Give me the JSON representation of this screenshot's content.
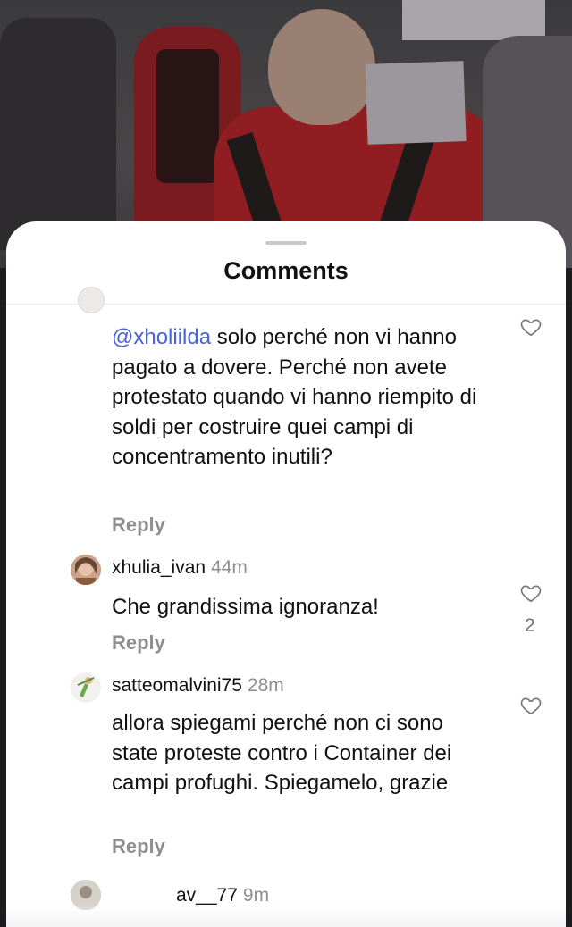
{
  "sheet": {
    "title": "Comments"
  },
  "comments": [
    {
      "mention": "@xholiilda",
      "text": " solo perché non vi hanno pagato a dovere. Perché non avete protestato quando vi hanno riempito di soldi per costruire quei campi di concentramento inutili?",
      "reply_label": "Reply"
    },
    {
      "username": "xhulia_ivan",
      "time": "44m",
      "text": "Che grandissima ignoranza!",
      "reply_label": "Reply",
      "like_count": "2"
    },
    {
      "username": "satteomalvini75",
      "time": "28m",
      "text": "allora spiegami perché non ci sono state proteste contro i Container dei campi profughi. Spiegamelo, grazie",
      "reply_label": "Reply"
    },
    {
      "username": "av__77",
      "time": "9m"
    }
  ],
  "icons": {
    "like": "heart-outline-icon"
  }
}
